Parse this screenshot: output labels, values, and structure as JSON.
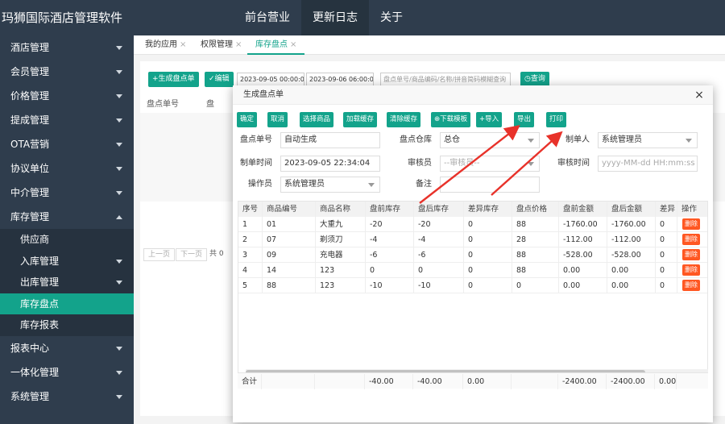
{
  "app": {
    "title": "玛狮国际酒店管理软件"
  },
  "topnav": [
    {
      "label": "前台营业"
    },
    {
      "label": "更新日志"
    },
    {
      "label": "关于"
    }
  ],
  "sidebar": {
    "items": [
      {
        "label": "酒店管理"
      },
      {
        "label": "会员管理"
      },
      {
        "label": "价格管理"
      },
      {
        "label": "提成管理"
      },
      {
        "label": "OTA营销"
      },
      {
        "label": "协议单位"
      },
      {
        "label": "中介管理"
      },
      {
        "label": "库存管理"
      }
    ],
    "sub": [
      {
        "label": "供应商"
      },
      {
        "label": "入库管理"
      },
      {
        "label": "出库管理"
      },
      {
        "label": "库存盘点"
      },
      {
        "label": "库存报表"
      }
    ],
    "after": [
      {
        "label": "报表中心"
      },
      {
        "label": "一体化管理"
      },
      {
        "label": "系统管理"
      }
    ]
  },
  "tabs": [
    {
      "label": "我的应用"
    },
    {
      "label": "权限管理"
    },
    {
      "label": "库存盘点"
    }
  ],
  "bg": {
    "new_btn": "+生成盘点单",
    "edit_btn": "✓编辑",
    "date_from": "2023-09-05 00:00:00",
    "date_to": "2023-09-06 06:00:00",
    "search_placeholder": "盘点单号/商品编码/名称/拼音简码模糊查询",
    "query_btn": "◷查询",
    "col_no": "盘点单号",
    "col_2": "盘",
    "prev": "上一页",
    "next": "下一页",
    "total_prefix": "共 0"
  },
  "modal": {
    "title": "生成盘点单",
    "buttons": [
      {
        "label": "确定"
      },
      {
        "label": "取消"
      },
      {
        "label": "选择商品"
      },
      {
        "label": "加载缓存"
      },
      {
        "label": "清除缓存"
      },
      {
        "label": "⊕下载模板"
      },
      {
        "label": "+导入"
      },
      {
        "label": "导出"
      },
      {
        "label": "打印"
      }
    ],
    "fields": {
      "no_label": "盘点单号",
      "no_value": "自动生成",
      "warehouse_label": "盘点仓库",
      "warehouse_value": "总仓",
      "maker_label": "制单人",
      "maker_value": "系统管理员",
      "time_label": "制单时间",
      "time_value": "2023-09-05 22:34:04",
      "auditor_label": "审核员",
      "auditor_value": "--审核员--",
      "audit_time_label": "审核时间",
      "audit_time_placeholder": "yyyy-MM-dd HH:mm:ss",
      "operator_label": "操作员",
      "operator_value": "系统管理员",
      "remark_label": "备注",
      "remark_value": ""
    },
    "table": {
      "headers": [
        "序号",
        "商品编号",
        "商品名称",
        "盘前库存",
        "盘后库存",
        "差异库存",
        "盘点价格",
        "盘前金额",
        "盘后金额",
        "差异",
        "操作"
      ],
      "rows": [
        [
          "1",
          "01",
          "大重九",
          "-20",
          "-20",
          "0",
          "88",
          "-1760.00",
          "-1760.00",
          "0"
        ],
        [
          "2",
          "07",
          "剃须刀",
          "-4",
          "-4",
          "0",
          "28",
          "-112.00",
          "-112.00",
          "0"
        ],
        [
          "3",
          "09",
          "充电器",
          "-6",
          "-6",
          "0",
          "88",
          "-528.00",
          "-528.00",
          "0"
        ],
        [
          "4",
          "14",
          "123",
          "0",
          "0",
          "0",
          "88",
          "0.00",
          "0.00",
          "0"
        ],
        [
          "5",
          "88",
          "123",
          "-10",
          "-10",
          "0",
          "0",
          "0.00",
          "0.00",
          "0"
        ]
      ],
      "delete_label": "删除",
      "totals": [
        "合计",
        "",
        "",
        "-40.00",
        "-40.00",
        "0.00",
        "",
        "-2400.00",
        "-2400.00",
        "0.00"
      ]
    }
  },
  "colors": {
    "sidebar": "#2f3d4d",
    "accent": "#13a38b",
    "danger": "#ff5722",
    "arrow": "#e8322a"
  }
}
